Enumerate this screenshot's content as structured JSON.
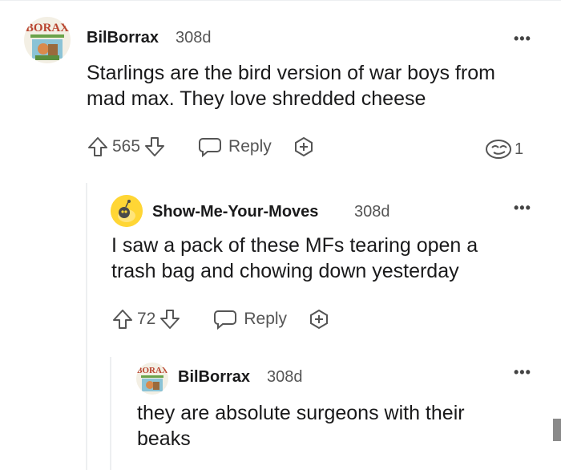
{
  "comments": [
    {
      "author": "BilBorrax",
      "age": "308d",
      "avatar_text": "BORAX",
      "body_lines": [
        "Starlings are the bird version of war boys from",
        "mad max. They love shredded cheese"
      ],
      "score": "565",
      "reply_label": "Reply",
      "more_label": "•••",
      "award_count": "1"
    },
    {
      "author": "Show-Me-Your-Moves",
      "age": "308d",
      "body_lines": [
        "I saw a pack of these MFs tearing open a",
        "trash bag and chowing down yesterday"
      ],
      "score": "72",
      "reply_label": "Reply",
      "more_label": "•••"
    },
    {
      "author": "BilBorrax",
      "age": "308d",
      "avatar_text": "BORAX",
      "body_lines": [
        "they are absolute surgeons with their",
        "beaks"
      ],
      "more_label": "•••"
    }
  ],
  "colors": {
    "avatar_yellow": "#ffd635",
    "text_primary": "#1a1a1b",
    "text_meta": "#555555",
    "thread_line": "#edeff1"
  }
}
